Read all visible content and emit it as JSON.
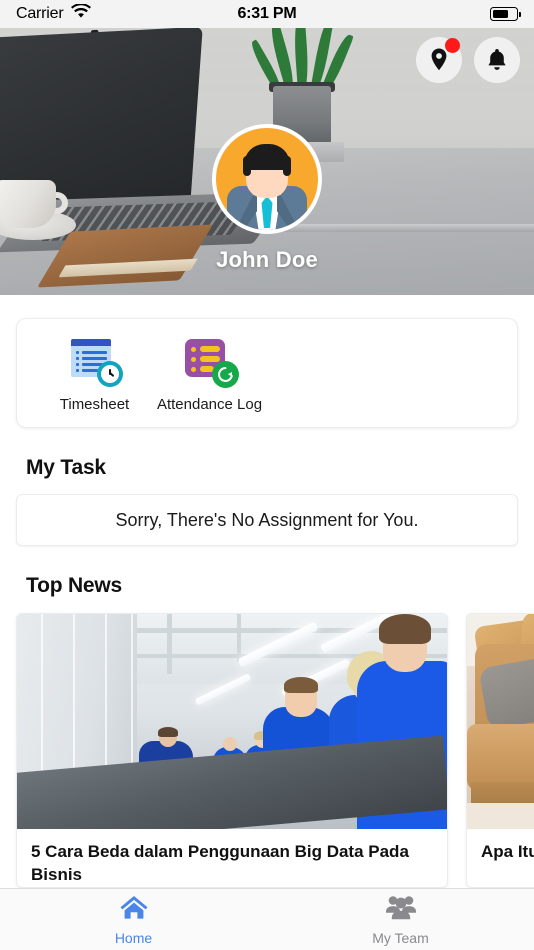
{
  "status_bar": {
    "carrier": "Carrier",
    "wifi_icon": "wifi-icon",
    "time": "6:31 PM",
    "battery_icon": "battery-icon"
  },
  "header": {
    "location_button": {
      "icon": "location-pin-icon",
      "has_badge": true,
      "badge_color": "#ff1a1a"
    },
    "notification_button": {
      "icon": "bell-icon"
    },
    "avatar": {
      "icon": "user-avatar-businessman",
      "background_color": "#f9a82e"
    },
    "user_name": "John Doe"
  },
  "quick_actions": [
    {
      "label": "Timesheet",
      "icon": "timesheet-icon"
    },
    {
      "label": "Attendance Log",
      "icon": "attendance-log-icon"
    }
  ],
  "my_task": {
    "title": "My Task",
    "empty_message": "Sorry, There's No Assignment for You."
  },
  "top_news": {
    "title": "Top News",
    "items": [
      {
        "image": "factory-assembly-line-photo",
        "title": "5 Cara Beda dalam Penggunaan Big Data Pada Bisnis"
      },
      {
        "image": "sofa-living-room-photo",
        "title": "Apa Itu Anti..."
      }
    ]
  },
  "tab_bar": {
    "active_color": "#4a86e8",
    "inactive_color": "#8a8a8e",
    "items": [
      {
        "label": "Home",
        "icon": "home-icon",
        "active": true
      },
      {
        "label": "My Team",
        "icon": "people-group-icon",
        "active": false
      }
    ]
  }
}
